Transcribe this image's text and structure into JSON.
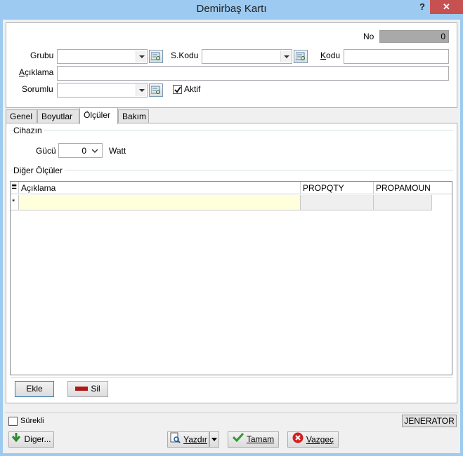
{
  "window": {
    "title": "Demirbaş Kartı",
    "help": "?",
    "close": "✕"
  },
  "header": {
    "no_label": "No",
    "no_value": "0",
    "grubu_label": "Grubu",
    "skodu_label": "S.Kodu",
    "kodu_label": "Kodu",
    "aciklama_label": "Açıklama",
    "sorumlu_label": "Sorumlu",
    "aktif_label": "Aktif",
    "aktif_checked": true
  },
  "tabs": [
    {
      "label": "Genel"
    },
    {
      "label": "Boyutlar"
    },
    {
      "label": "Ölçüler"
    },
    {
      "label": "Bakım"
    }
  ],
  "active_tab": "Ölçüler",
  "olculer": {
    "cihazin_title": "Cihazın",
    "gucu_label": "Gücü",
    "gucu_value": "0",
    "watt_label": "Watt",
    "diger_title": "Diğer Ölçüler"
  },
  "grid": {
    "header_icon": "≣",
    "columns": [
      "Açıklama",
      "PROPQTY",
      "PROPAMOUN"
    ],
    "new_row_marker": "*"
  },
  "buttons": {
    "ekle": "Ekle",
    "sil": "Sil",
    "diger": "Diger...",
    "yazdir": "Yazdır",
    "tamam": "Tamam",
    "vazgec": "Vazgeç"
  },
  "footer": {
    "surekli_label": "Sürekli",
    "jenerator": "JENERATOR"
  }
}
